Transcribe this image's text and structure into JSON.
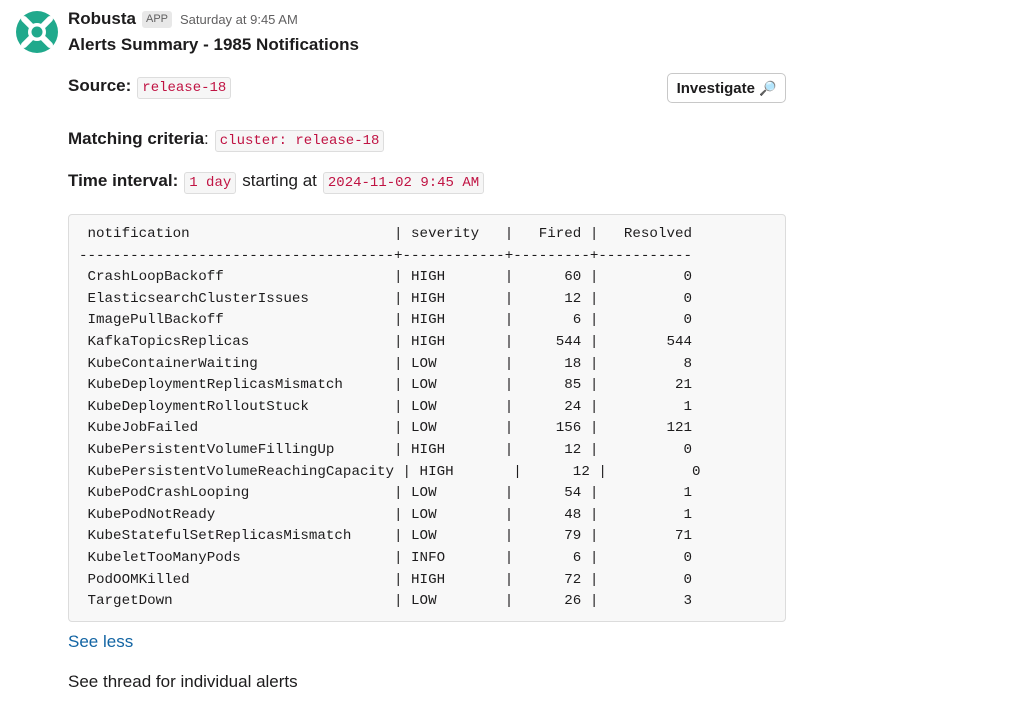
{
  "header": {
    "sender": "Robusta",
    "badge": "APP",
    "timestamp": "Saturday at 9:45 AM"
  },
  "message": {
    "title": "Alerts Summary - 1985 Notifications",
    "source_label": "Source:",
    "source_value": "release-18",
    "criteria_label": "Matching criteria",
    "criteria_colon": ":",
    "criteria_value": "cluster: release-18",
    "interval_label": "Time interval:",
    "interval_value": "1 day",
    "interval_mid": "starting at",
    "interval_start": "2024-11-02 9:45 AM",
    "investigate_label": "Investigate",
    "investigate_icon": "🔎",
    "see_less": "See less",
    "footer": "See thread for individual alerts"
  },
  "table": {
    "lines": [
      " notification                        | severity   |   Fired |   Resolved",
      "-------------------------------------+------------+---------+-----------",
      " CrashLoopBackoff                    | HIGH       |      60 |          0",
      " ElasticsearchClusterIssues          | HIGH       |      12 |          0",
      " ImagePullBackoff                    | HIGH       |       6 |          0",
      " KafkaTopicsReplicas                 | HIGH       |     544 |        544",
      " KubeContainerWaiting                | LOW        |      18 |          8",
      " KubeDeploymentReplicasMismatch      | LOW        |      85 |         21",
      " KubeDeploymentRolloutStuck          | LOW        |      24 |          1",
      " KubeJobFailed                       | LOW        |     156 |        121",
      " KubePersistentVolumeFillingUp       | HIGH       |      12 |          0",
      " KubePersistentVolumeReachingCapacity | HIGH       |      12 |          0",
      " KubePodCrashLooping                 | LOW        |      54 |          1",
      " KubePodNotReady                     | LOW        |      48 |          1",
      " KubeStatefulSetReplicasMismatch     | LOW        |      79 |         71",
      " KubeletTooManyPods                  | INFO       |       6 |          0",
      " PodOOMKilled                        | HIGH       |      72 |          0",
      " TargetDown                          | LOW        |      26 |          3"
    ]
  },
  "colors": {
    "link": "#1264a3",
    "code_text": "#c01343",
    "avatar": "#20a98c"
  },
  "icons": {
    "avatar": "robusta-logo-icon",
    "investigate": "magnifier-icon"
  }
}
